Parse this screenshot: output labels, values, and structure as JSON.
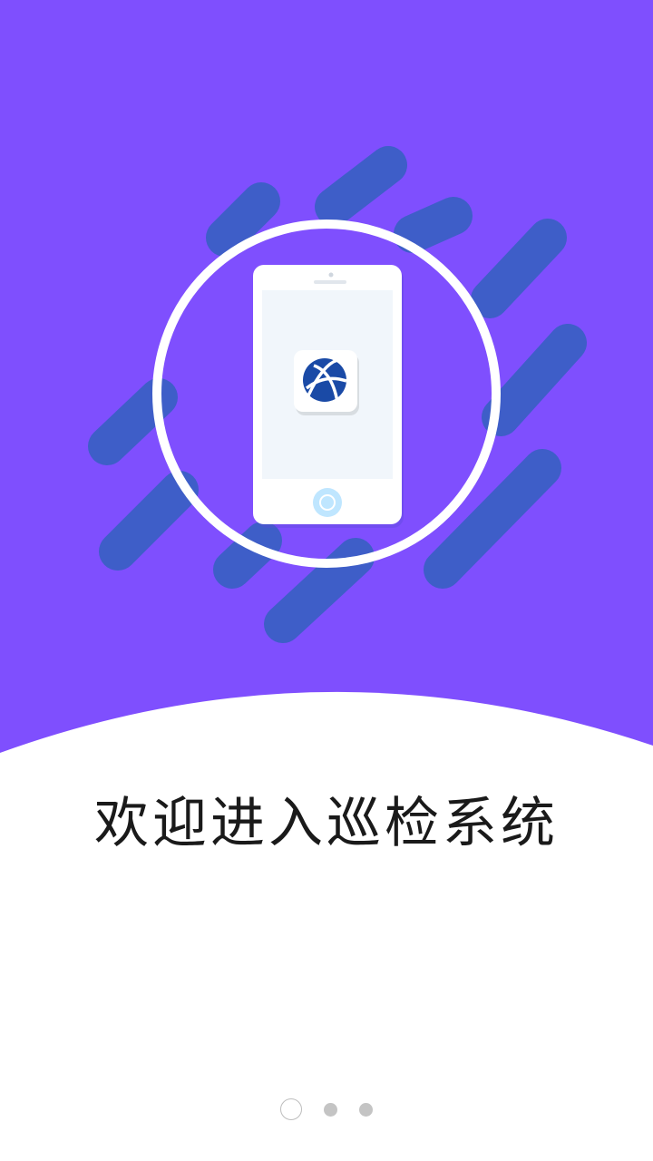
{
  "colors": {
    "background_top": "#7f4ffe",
    "stripes": "#3e5ec8",
    "circle_ring": "#ffffff",
    "phone_body": "#ffffff",
    "phone_screen": "#f1f6fb",
    "home_button": "#bfe6ff",
    "logo_blue": "#1a4aa6",
    "text": "#1a1a1a"
  },
  "illustration": {
    "phone_icon": "phone-icon",
    "app_logo_icon": "globe-logo-icon"
  },
  "welcome": {
    "title": "欢迎进入巡检系统"
  },
  "pager": {
    "total": 3,
    "active_index": 0
  }
}
